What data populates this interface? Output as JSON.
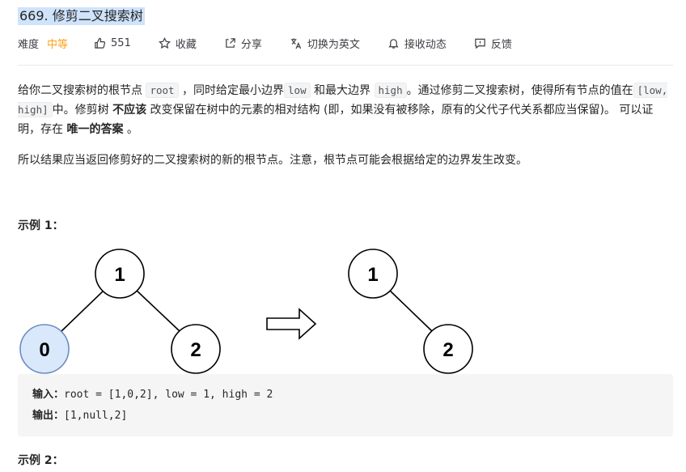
{
  "problem": {
    "title": "669. 修剪二叉搜索树",
    "difficulty_label": "难度",
    "difficulty": "中等",
    "likes": "551",
    "favorite": "收藏",
    "share": "分享",
    "translate": "切换为英文",
    "subscribe": "接收动态",
    "feedback": "反馈"
  },
  "description": {
    "p1_a": "给你二叉搜索树的根节点 ",
    "code_root": "root",
    "p1_b": " ，同时给定最小边界",
    "code_low": "low",
    "p1_c": " 和最大边界 ",
    "code_high": "high",
    "p1_d": "。通过修剪二叉搜索树，使得所有节点的值在",
    "code_range": "[low, high]",
    "p1_e": "中。修剪树 ",
    "bold_1": "不应该",
    "p1_f": " 改变保留在树中的元素的相对结构 (即，如果没有被移除，原有的父代子代关系都应当保留)。 可以证明，存在 ",
    "bold_2": "唯一的答案",
    "p1_g": " 。",
    "p2": "所以结果应当返回修剪好的二叉搜索树的新的根节点。注意，根节点可能会根据给定的边界发生改变。"
  },
  "example1": {
    "title": "示例 1：",
    "before_nodes": [
      "1",
      "0",
      "2"
    ],
    "after_nodes": [
      "1",
      "2"
    ],
    "input_label": "输入：",
    "input_value": "root = [1,0,2], low = 1, high = 2",
    "output_label": "输出：",
    "output_value": "[1,null,2]"
  },
  "example2": {
    "title": "示例 2："
  },
  "colors": {
    "accent_medium": "#ffa116",
    "title_highlight": "#cfe3fb",
    "removed_node_fill": "#dae8fc",
    "removed_node_stroke": "#6c8ebf"
  },
  "icons": [
    "thumbs-up-icon",
    "star-icon",
    "share-icon",
    "translate-icon",
    "bell-icon",
    "feedback-icon",
    "arrow-right-icon"
  ]
}
